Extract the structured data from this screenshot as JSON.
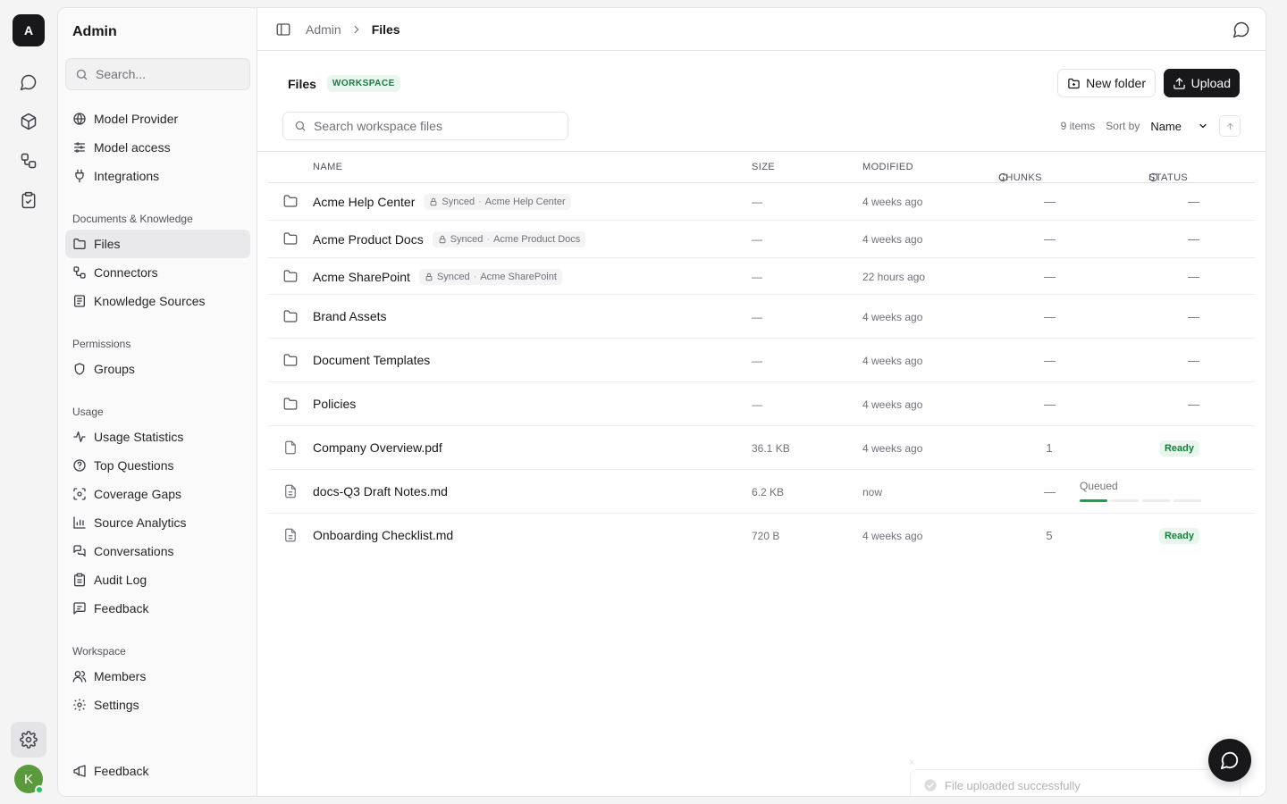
{
  "rail": {
    "logo_letter": "A",
    "avatar_letter": "K",
    "icons": [
      "chat-icon",
      "cube-icon",
      "workflow-icon",
      "clipboard-icon"
    ],
    "settings_icon": "gear-icon"
  },
  "sidebar": {
    "title": "Admin",
    "search_placeholder": "Search...",
    "items_top": [
      {
        "label": "Model Provider",
        "icon": "globe-icon"
      },
      {
        "label": "Model access",
        "icon": "sliders-icon"
      },
      {
        "label": "Integrations",
        "icon": "plug-icon"
      }
    ],
    "sections": [
      {
        "title": "Documents & Knowledge",
        "items": [
          {
            "label": "Files",
            "icon": "folder-icon",
            "active": true
          },
          {
            "label": "Connectors",
            "icon": "connector-icon"
          },
          {
            "label": "Knowledge Sources",
            "icon": "book-icon"
          }
        ]
      },
      {
        "title": "Permissions",
        "items": [
          {
            "label": "Groups",
            "icon": "shield-icon"
          }
        ]
      },
      {
        "title": "Usage",
        "items": [
          {
            "label": "Usage Statistics",
            "icon": "activity-icon"
          },
          {
            "label": "Top Questions",
            "icon": "question-icon"
          },
          {
            "label": "Coverage Gaps",
            "icon": "scan-icon"
          },
          {
            "label": "Source Analytics",
            "icon": "bar-chart-icon"
          },
          {
            "label": "Conversations",
            "icon": "messages-icon"
          },
          {
            "label": "Audit Log",
            "icon": "clipboard-list-icon"
          },
          {
            "label": "Feedback",
            "icon": "message-square-icon"
          }
        ]
      },
      {
        "title": "Workspace",
        "items": [
          {
            "label": "Members",
            "icon": "users-icon"
          },
          {
            "label": "Settings",
            "icon": "gear-icon"
          }
        ]
      }
    ],
    "footer_feedback": "Feedback"
  },
  "topbar": {
    "crumb_parent": "Admin",
    "crumb_current": "Files"
  },
  "files": {
    "title": "Files",
    "badge": "WORKSPACE",
    "new_folder_label": "New folder",
    "upload_label": "Upload",
    "search_placeholder": "Search workspace files",
    "items_count": "9 items",
    "sort_label": "Sort by",
    "sort_value": "Name",
    "columns": {
      "name": "NAME",
      "size": "SIZE",
      "modified": "MODIFIED",
      "chunks": "CHUNKS",
      "status": "STATUS"
    },
    "rows": [
      {
        "type": "folder",
        "name": "Acme Help Center",
        "synced": "Synced",
        "source": "Acme Help Center",
        "size": "—",
        "modified": "4 weeks ago",
        "chunks": "—",
        "status": "—"
      },
      {
        "type": "folder",
        "name": "Acme Product Docs",
        "synced": "Synced",
        "source": "Acme Product Docs",
        "size": "—",
        "modified": "4 weeks ago",
        "chunks": "—",
        "status": "—"
      },
      {
        "type": "folder",
        "name": "Acme SharePoint",
        "synced": "Synced",
        "source": "Acme SharePoint",
        "size": "—",
        "modified": "22 hours ago",
        "chunks": "—",
        "status": "—"
      },
      {
        "type": "folder",
        "name": "Brand Assets",
        "size": "—",
        "modified": "4 weeks ago",
        "chunks": "—",
        "status": "—"
      },
      {
        "type": "folder",
        "name": "Document Templates",
        "size": "—",
        "modified": "4 weeks ago",
        "chunks": "—",
        "status": "—"
      },
      {
        "type": "folder",
        "name": "Policies",
        "size": "—",
        "modified": "4 weeks ago",
        "chunks": "—",
        "status": "—"
      },
      {
        "type": "file",
        "name": "Company Overview.pdf",
        "size": "36.1 KB",
        "modified": "4 weeks ago",
        "chunks": "1",
        "status": "Ready"
      },
      {
        "type": "file-text",
        "name": "docs-Q3 Draft Notes.md",
        "size": "6.2 KB",
        "modified": "now",
        "chunks": "—",
        "status": "Queued",
        "progress": 0.25
      },
      {
        "type": "file-text",
        "name": "Onboarding Checklist.md",
        "size": "720 B",
        "modified": "4 weeks ago",
        "chunks": "5",
        "status": "Ready"
      }
    ]
  },
  "toast": {
    "message": "File uploaded successfully",
    "close": "×"
  },
  "colors": {
    "accent": "#18181b",
    "ready_bg": "#e8f6ee",
    "ready_fg": "#15803d",
    "progress": "#16a34a"
  }
}
